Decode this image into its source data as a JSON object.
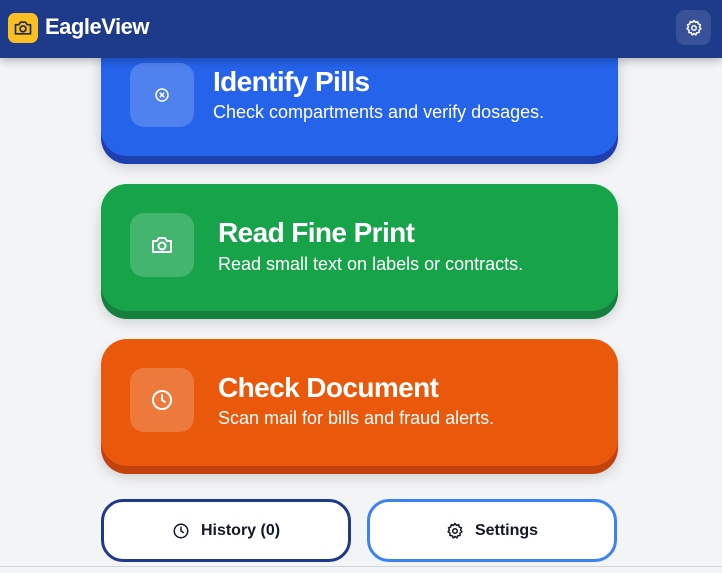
{
  "app": {
    "title": "EagleView"
  },
  "cards": [
    {
      "title": "Identify Pills",
      "subtitle": "Check compartments and verify dosages.",
      "icon": "pill-icon",
      "color": "#2563eb"
    },
    {
      "title": "Read Fine Print",
      "subtitle": "Read small text on labels or contracts.",
      "icon": "camera-icon",
      "color": "#16a34a"
    },
    {
      "title": "Check Document",
      "subtitle": "Scan mail for bills and fraud alerts.",
      "icon": "clock-icon",
      "color": "#ea580c"
    }
  ],
  "bottom": {
    "history_label": "History (0)",
    "settings_label": "Settings"
  },
  "colors": {
    "header": "#1e3a8a",
    "logo": "#fbbf24",
    "background": "#f3f4f6"
  }
}
